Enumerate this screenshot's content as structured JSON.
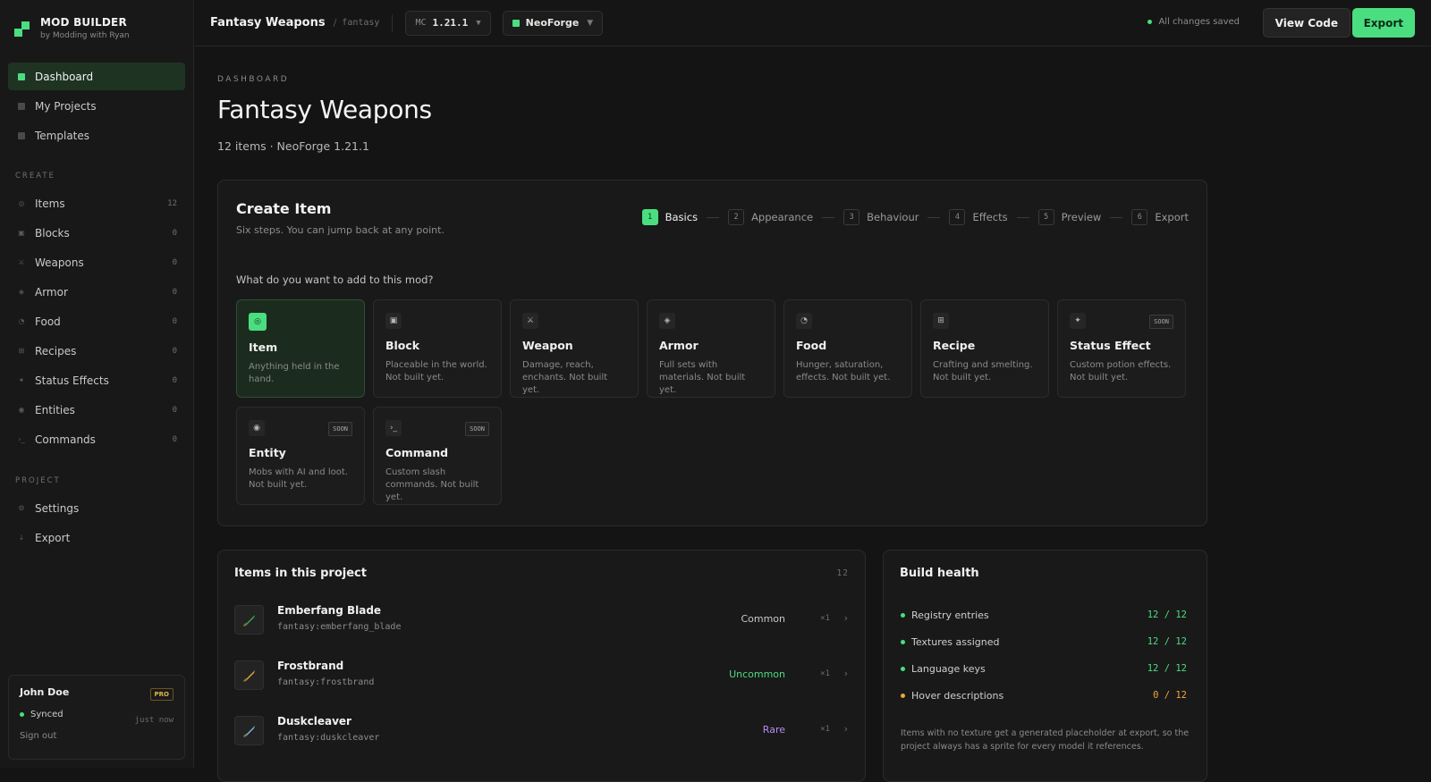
{
  "app": {
    "title": "MOD BUILDER",
    "subtitle": "by Modding with Ryan"
  },
  "nav": {
    "main": [
      {
        "label": "Dashboard"
      },
      {
        "label": "My Projects"
      },
      {
        "label": "Templates"
      }
    ],
    "create_heading": "CREATE",
    "create": [
      {
        "label": "Items",
        "count": "12",
        "icon": "coin-icon",
        "glyph": "◎"
      },
      {
        "label": "Blocks",
        "count": "0",
        "icon": "block-icon",
        "glyph": "▣"
      },
      {
        "label": "Weapons",
        "count": "0",
        "icon": "sword-icon",
        "glyph": "⚔"
      },
      {
        "label": "Armor",
        "count": "0",
        "icon": "armor-icon",
        "glyph": "◈"
      },
      {
        "label": "Food",
        "count": "0",
        "icon": "food-icon",
        "glyph": "◔"
      },
      {
        "label": "Recipes",
        "count": "0",
        "icon": "recipe-icon",
        "glyph": "⊞"
      },
      {
        "label": "Status Effects",
        "count": "0",
        "icon": "sparkle-icon",
        "glyph": "✦"
      },
      {
        "label": "Entities",
        "count": "0",
        "icon": "entity-icon",
        "glyph": "◉"
      },
      {
        "label": "Commands",
        "count": "0",
        "icon": "terminal-icon",
        "glyph": "›_"
      }
    ],
    "project_heading": "PROJECT",
    "project": [
      {
        "label": "Settings",
        "icon": "gear-icon",
        "glyph": "⚙"
      },
      {
        "label": "Export",
        "icon": "download-icon",
        "glyph": "↓"
      }
    ]
  },
  "user": {
    "name": "John Doe",
    "badge": "PRO",
    "status": "Synced",
    "when": "just now",
    "signout": "Sign out"
  },
  "topbar": {
    "project": "Fantasy Weapons",
    "slug": "fantasy",
    "mc_label": "MC",
    "mc_version": "1.21.1",
    "loader": "NeoForge",
    "saved": "All changes saved",
    "view_code": "View Code",
    "export": "Export"
  },
  "page": {
    "crumb": "DASHBOARD",
    "title": "Fantasy Weapons",
    "meta": "12 items · NeoForge 1.21.1"
  },
  "create_item": {
    "title": "Create Item",
    "subtitle": "Six steps. You can jump back at any point.",
    "question": "What do you want to add to this mod?",
    "steps": [
      {
        "n": "1",
        "label": "Basics"
      },
      {
        "n": "2",
        "label": "Appearance"
      },
      {
        "n": "3",
        "label": "Behaviour"
      },
      {
        "n": "4",
        "label": "Effects"
      },
      {
        "n": "5",
        "label": "Preview"
      },
      {
        "n": "6",
        "label": "Export"
      }
    ],
    "tiles": [
      {
        "name": "Item",
        "desc": "Anything held in the hand.",
        "glyph": "◎",
        "icon": "coin-icon"
      },
      {
        "name": "Block",
        "desc": "Placeable in the world. Not built yet.",
        "glyph": "▣",
        "icon": "block-icon"
      },
      {
        "name": "Weapon",
        "desc": "Damage, reach, enchants. Not built yet.",
        "glyph": "⚔",
        "icon": "sword-icon"
      },
      {
        "name": "Armor",
        "desc": "Full sets with materials. Not built yet.",
        "glyph": "◈",
        "icon": "armor-icon"
      },
      {
        "name": "Food",
        "desc": "Hunger, saturation, effects. Not built yet.",
        "glyph": "◔",
        "icon": "food-icon"
      },
      {
        "name": "Recipe",
        "desc": "Crafting and smelting. Not built yet.",
        "glyph": "⊞",
        "icon": "recipe-icon"
      },
      {
        "name": "Status Effect",
        "desc": "Custom potion effects. Not built yet.",
        "glyph": "✦",
        "icon": "sparkle-icon",
        "soon": "SOON"
      },
      {
        "name": "Entity",
        "desc": "Mobs with AI and loot. Not built yet.",
        "glyph": "◉",
        "icon": "entity-icon",
        "soon": "SOON"
      },
      {
        "name": "Command",
        "desc": "Custom slash commands. Not built yet.",
        "glyph": "›_",
        "icon": "terminal-icon",
        "soon": "SOON"
      }
    ]
  },
  "items": {
    "title": "Items in this project",
    "count": "12",
    "rows": [
      {
        "name": "Emberfang Blade",
        "id": "fantasy:emberfang_blade",
        "rarity": "Common",
        "rarity_color": "#c9c9c6",
        "qty": "×1",
        "blade": "#3ea84f"
      },
      {
        "name": "Frostbrand",
        "id": "fantasy:frostbrand",
        "rarity": "Uncommon",
        "rarity_color": "#4ade80",
        "qty": "×1",
        "blade": "#e2a93a"
      },
      {
        "name": "Duskcleaver",
        "id": "fantasy:duskcleaver",
        "rarity": "Rare",
        "rarity_color": "#b58cf5",
        "qty": "×1",
        "blade": "#7fb4e0"
      }
    ]
  },
  "health": {
    "title": "Build health",
    "rows": [
      {
        "label": "Registry entries",
        "value": "12 / 12",
        "color": "#4ade80"
      },
      {
        "label": "Textures assigned",
        "value": "12 / 12",
        "color": "#4ade80"
      },
      {
        "label": "Language keys",
        "value": "12 / 12",
        "color": "#4ade80"
      },
      {
        "label": "Hover descriptions",
        "value": "0 / 12",
        "color": "#f0a53a"
      }
    ],
    "note": "Items with no texture get a generated placeholder at export, so the project always has a sprite for every model it references."
  }
}
